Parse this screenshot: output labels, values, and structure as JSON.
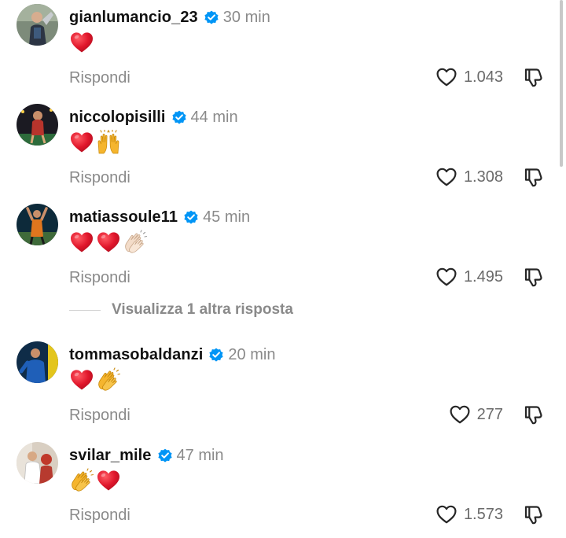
{
  "labels": {
    "reply": "Rispondi",
    "view_replies": "Visualizza 1 altra risposta"
  },
  "icons": {
    "verified": "verified-badge-icon",
    "like": "heart-outline-icon",
    "dislike": "thumbs-down-icon"
  },
  "colors": {
    "verified": "#0095f6",
    "muted_text": "#8a8a8a",
    "heart_emoji": "#e0162b"
  },
  "comments": [
    {
      "username": "gianlumancio_23",
      "time": "30 min",
      "emojis": [
        "red-heart"
      ],
      "likes": "1.043"
    },
    {
      "username": "niccolopisilli",
      "time": "44 min",
      "emojis": [
        "red-heart",
        "raising-hands"
      ],
      "likes": "1.308"
    },
    {
      "username": "matiassoule11",
      "time": "45 min",
      "emojis": [
        "red-heart",
        "red-heart",
        "clapping-hands-light"
      ],
      "likes": "1.495"
    },
    {
      "username": "tommasobaldanzi",
      "time": "20 min",
      "emojis": [
        "red-heart",
        "clapping-hands"
      ],
      "likes": "277"
    },
    {
      "username": "svilar_mile",
      "time": "47 min",
      "emojis": [
        "clapping-hands",
        "red-heart"
      ],
      "likes": "1.573"
    }
  ]
}
